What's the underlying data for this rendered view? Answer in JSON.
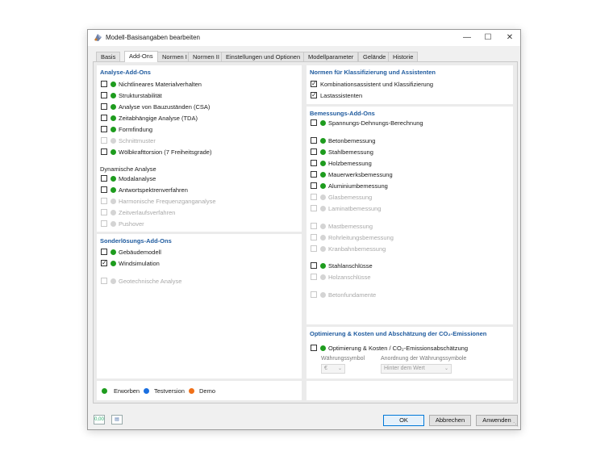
{
  "window": {
    "title": "Modell-Basisangaben bearbeiten",
    "controls": {
      "minimize": "—",
      "maximize": "☐",
      "close": "✕"
    }
  },
  "tabs": [
    "Basis",
    "Add-Ons",
    "Normen I",
    "Normen II",
    "Einstellungen und Optionen",
    "Modellparameter",
    "Gelände",
    "Historie"
  ],
  "colors": {
    "green": "#1e9c1e",
    "blue": "#1a6fe0",
    "orange": "#f07018",
    "disabled_dot": "#d4d4d4",
    "title_blue": "#1e5a9e"
  },
  "analyse": {
    "title": "Analyse-Add-Ons",
    "items": [
      {
        "label": "Nichtlineares Materialverhalten",
        "checked": false,
        "enabled": true
      },
      {
        "label": "Strukturstabilität",
        "checked": false,
        "enabled": true
      },
      {
        "label": "Analyse von Bauzuständen (CSA)",
        "checked": false,
        "enabled": true
      },
      {
        "label": "Zeitabhängige Analyse (TDA)",
        "checked": false,
        "enabled": true
      },
      {
        "label": "Formfindung",
        "checked": false,
        "enabled": true
      },
      {
        "label": "Schnittmuster",
        "checked": false,
        "enabled": false
      },
      {
        "label": "Wölbkrafttorsion (7 Freiheitsgrade)",
        "checked": false,
        "enabled": true
      }
    ],
    "dyn_title": "Dynamische Analyse",
    "dyn_items": [
      {
        "label": "Modalanalyse",
        "checked": false,
        "enabled": true
      },
      {
        "label": "Antwortspektrenverfahren",
        "checked": false,
        "enabled": true
      },
      {
        "label": "Harmonische Frequenzganganalyse",
        "checked": false,
        "enabled": false
      },
      {
        "label": "Zeitverlaufsverfahren",
        "checked": false,
        "enabled": false
      },
      {
        "label": "Pushover",
        "checked": false,
        "enabled": false
      }
    ]
  },
  "sonder": {
    "title": "Sonderlösungs-Add-Ons",
    "items": [
      {
        "label": "Gebäudemodell",
        "checked": false,
        "enabled": true
      },
      {
        "label": "Windsimulation",
        "checked": true,
        "enabled": true
      },
      {
        "label": "Geotechnische Analyse",
        "checked": false,
        "enabled": false
      }
    ]
  },
  "normen": {
    "title": "Normen für Klassifizierung und Assistenten",
    "items": [
      {
        "label": "Kombinationsassistent und Klassifizierung",
        "checked": true
      },
      {
        "label": "Lastassistenten",
        "checked": true
      }
    ]
  },
  "bemessung": {
    "title": "Bemessungs-Add-Ons",
    "items": [
      {
        "label": "Spannungs-Dehnungs-Berechnung",
        "checked": false,
        "enabled": true
      },
      {
        "label": "Betonbemessung",
        "checked": false,
        "enabled": true
      },
      {
        "label": "Stahlbemessung",
        "checked": false,
        "enabled": true
      },
      {
        "label": "Holzbemessung",
        "checked": false,
        "enabled": true
      },
      {
        "label": "Mauerwerksbemessung",
        "checked": false,
        "enabled": true
      },
      {
        "label": "Aluminiumbemessung",
        "checked": false,
        "enabled": true
      },
      {
        "label": "Glasbemessung",
        "checked": false,
        "enabled": false
      },
      {
        "label": "Laminatbemessung",
        "checked": false,
        "enabled": false
      },
      {
        "label": "Mastbemessung",
        "checked": false,
        "enabled": false
      },
      {
        "label": "Rohrleitungsbemessung",
        "checked": false,
        "enabled": false
      },
      {
        "label": "Kranbahnbemessung",
        "checked": false,
        "enabled": false
      },
      {
        "label": "Stahlanschlüsse",
        "checked": false,
        "enabled": true
      },
      {
        "label": "Holzanschlüsse",
        "checked": false,
        "enabled": false
      },
      {
        "label": "Betonfundamente",
        "checked": false,
        "enabled": false
      }
    ]
  },
  "opt": {
    "title": "Optimierung & Kosten und Abschätzung der CO₂-Emissionen",
    "item": {
      "label": "Optimierung & Kosten / CO₂-Emissionsabschätzung",
      "checked": false
    },
    "currency_label": "Währungssymbol",
    "currency_value": "€",
    "arrangement_label": "Anordnung der Währungssymbole",
    "arrangement_value": "Hinter dem Wert"
  },
  "legend": {
    "acquired": "Erworben",
    "trial": "Testversion",
    "demo": "Demo"
  },
  "footer": {
    "ok": "OK",
    "cancel": "Abbrechen",
    "apply": "Anwenden",
    "icon1": "0,00",
    "icon2": "▤"
  }
}
